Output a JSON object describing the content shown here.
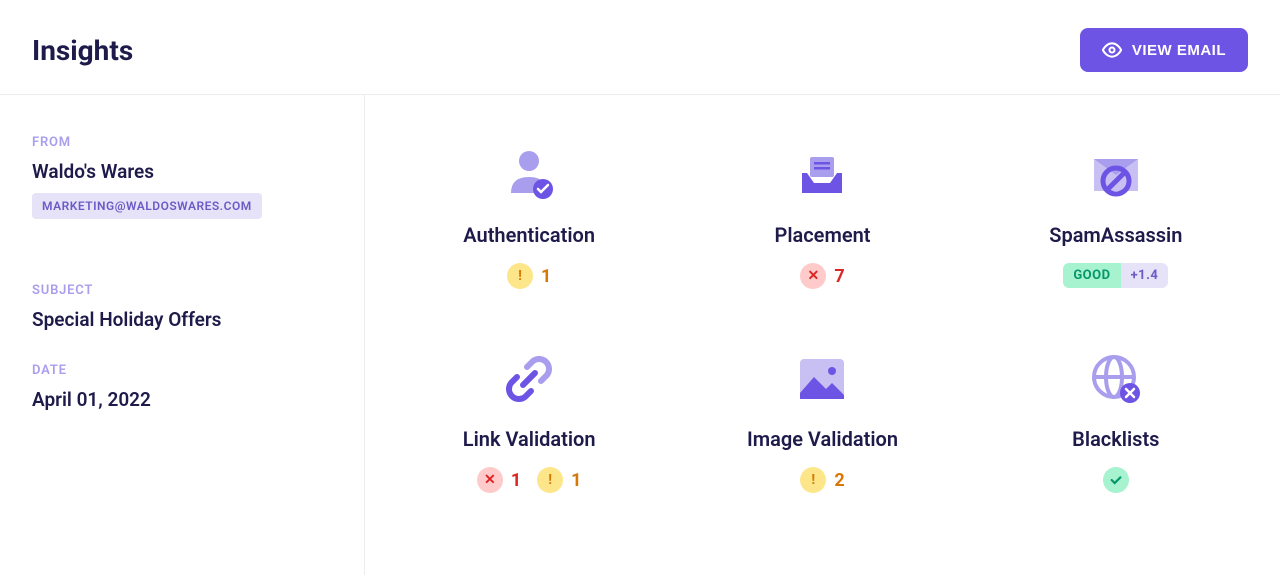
{
  "header": {
    "title": "Insights",
    "view_button": "VIEW EMAIL"
  },
  "sidebar": {
    "from_label": "FROM",
    "from_value": "Waldo's Wares",
    "from_email": "MARKETING@WALDOSWARES.COM",
    "subject_label": "SUBJECT",
    "subject_value": "Special Holiday Offers",
    "date_label": "DATE",
    "date_value": "April 01, 2022"
  },
  "cards": {
    "authentication": {
      "title": "Authentication",
      "warn_count": "1"
    },
    "placement": {
      "title": "Placement",
      "error_count": "7"
    },
    "spamassassin": {
      "title": "SpamAssassin",
      "good_label": "GOOD",
      "score": "+1.4"
    },
    "link_validation": {
      "title": "Link Validation",
      "error_count": "1",
      "warn_count": "1"
    },
    "image_validation": {
      "title": "Image Validation",
      "warn_count": "2"
    },
    "blacklists": {
      "title": "Blacklists"
    }
  }
}
